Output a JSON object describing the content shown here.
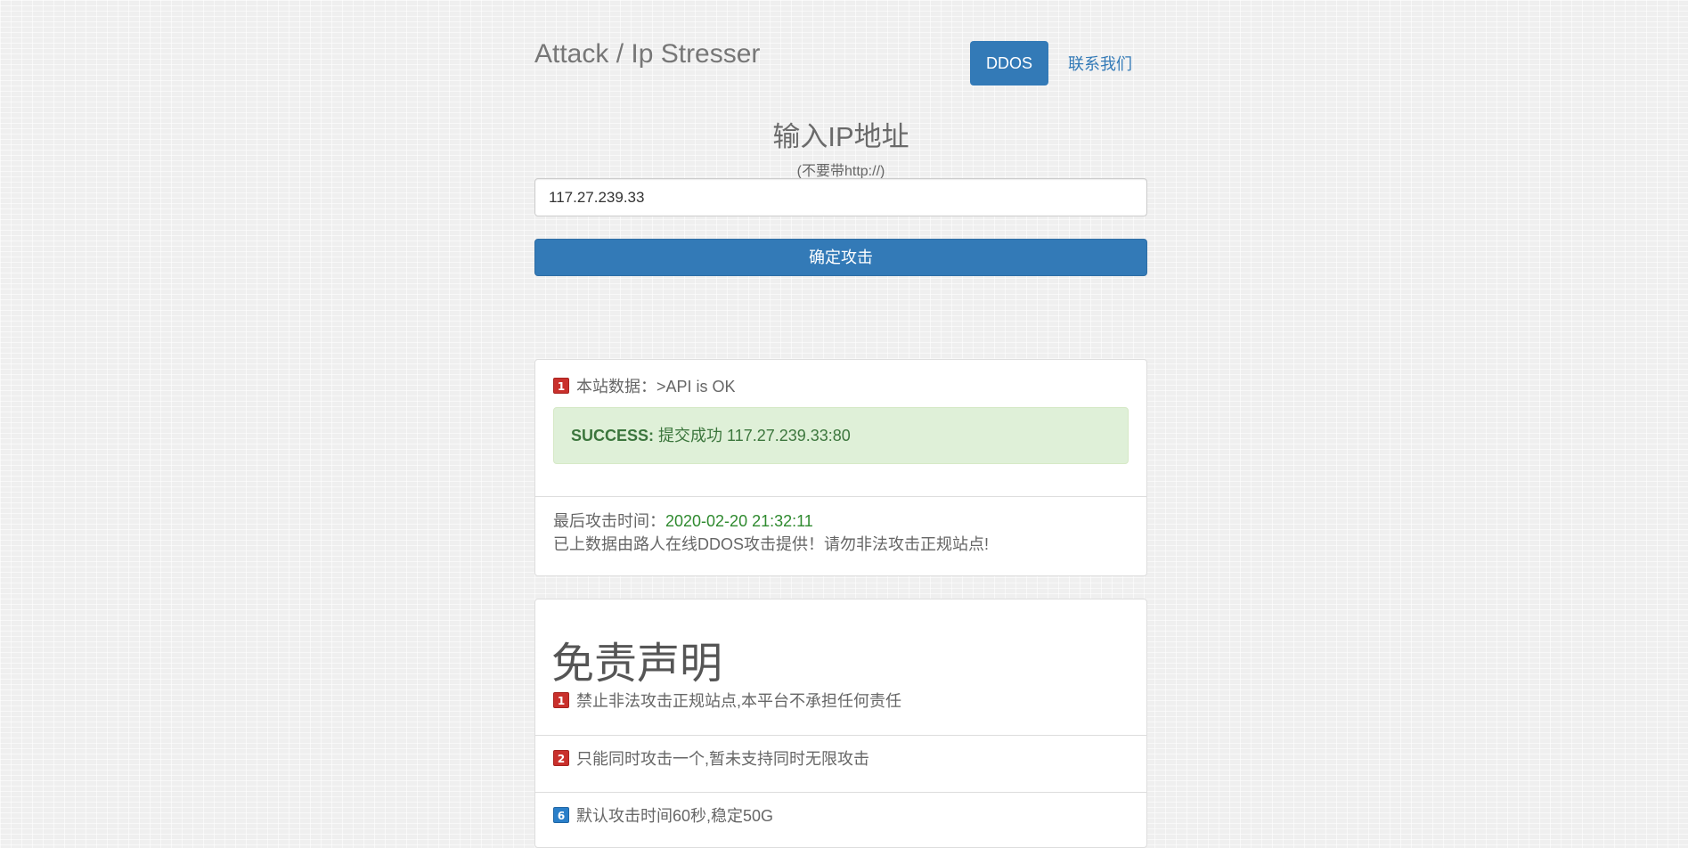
{
  "header": {
    "brand": "Attack / Ip Stresser",
    "nav_active": "DDOS",
    "nav_contact": "联系我们"
  },
  "form": {
    "title": "输入IP地址",
    "subtitle": "(不要带http://)",
    "ip_value": "117.27.239.33",
    "submit_label": "确定攻击"
  },
  "status_panel": {
    "badge": "1",
    "header_text": "本站数据：>API is OK",
    "alert_label": "SUCCESS:",
    "alert_text": " 提交成功 117.27.239.33:80",
    "last_time_label": "最后攻击时间：",
    "last_time_value": "2020-02-20 21:32:11",
    "note": "已上数据由路人在线DDOS攻击提供！请勿非法攻击正规站点!"
  },
  "disclaimer": {
    "title": "免责声明",
    "items": [
      {
        "badge": "1",
        "color": "#c9302c",
        "text": "禁止非法攻击正规站点,本平台不承担任何责任"
      },
      {
        "badge": "2",
        "color": "#c9302c",
        "text": "只能同时攻击一个,暂未支持同时无限攻击"
      },
      {
        "badge": "6",
        "color": "#2a7fc9",
        "text": "默认攻击时间60秒,稳定50G"
      }
    ]
  }
}
